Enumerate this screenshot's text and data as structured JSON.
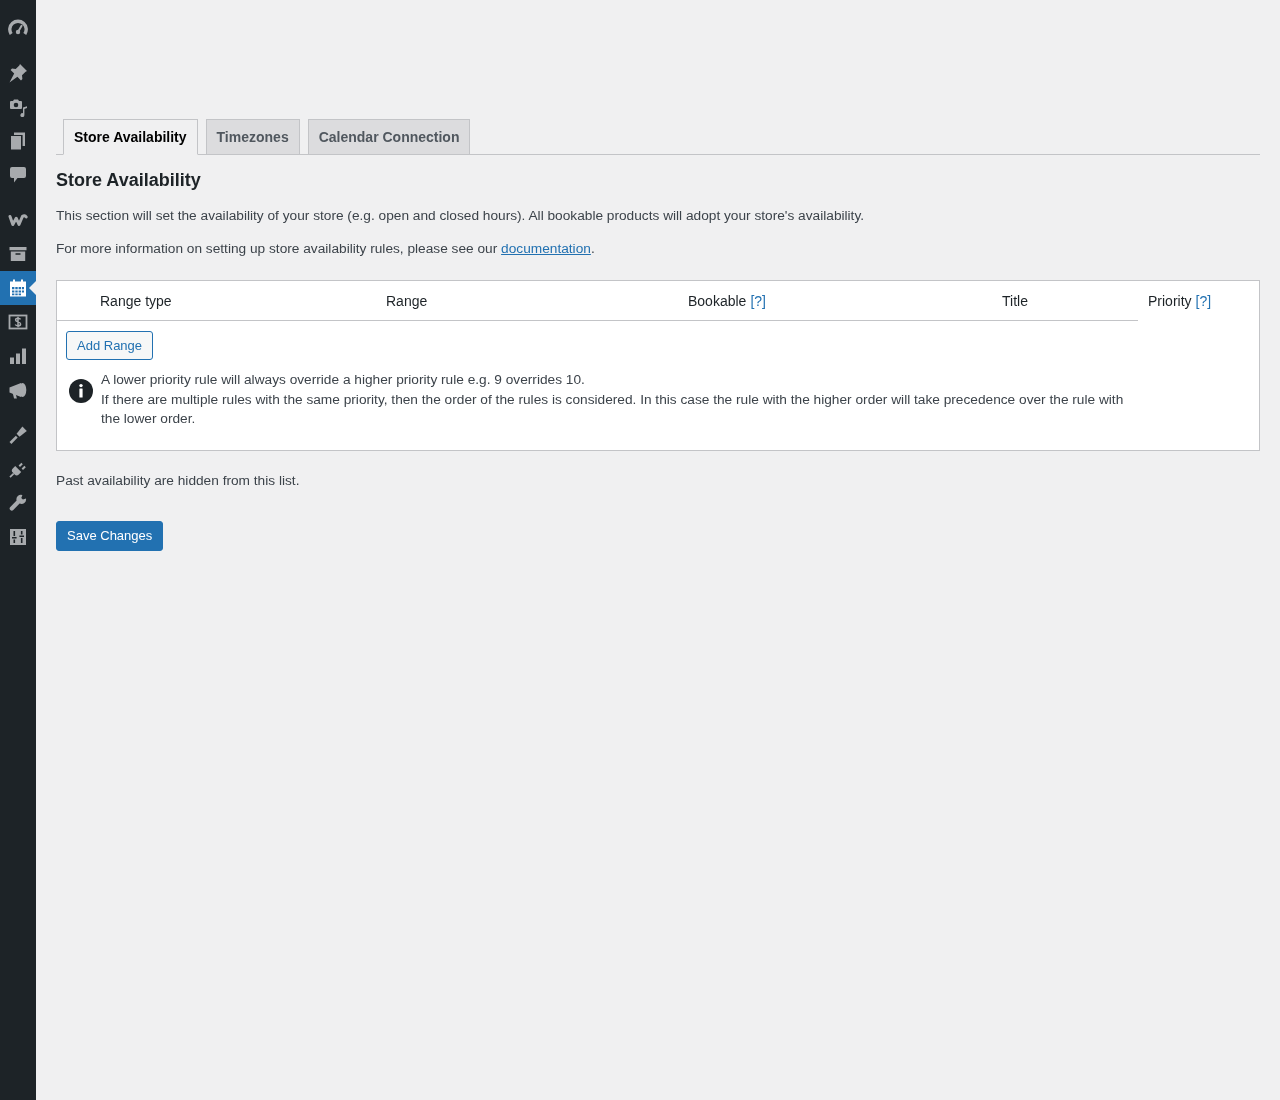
{
  "sidebar": {
    "groups": [
      {
        "items": [
          {
            "selected": false
          }
        ]
      },
      {
        "items": [
          {
            "selected": false
          },
          {
            "selected": false
          },
          {
            "selected": false
          },
          {
            "selected": false
          }
        ]
      },
      {
        "items": [
          {
            "selected": false
          },
          {
            "selected": false
          },
          {
            "selected": true
          },
          {
            "selected": false
          },
          {
            "selected": false
          },
          {
            "selected": false
          }
        ]
      },
      {
        "items": [
          {
            "selected": false
          },
          {
            "selected": false
          },
          {
            "selected": false
          },
          {
            "selected": false
          }
        ]
      }
    ]
  },
  "tabs": [
    {
      "label": "Store Availability",
      "selected": true
    },
    {
      "label": "Timezones",
      "selected": false
    },
    {
      "label": "Calendar Connection",
      "selected": false
    }
  ],
  "section": {
    "title": "Store Availability",
    "description": "This section will set the availability of your store (e.g. open and closed hours). All bookable products will adopt your store's availability.",
    "more_info": {
      "text": "For more information on setting up store availability rules, please see our ",
      "link": "documentation",
      "after": "."
    }
  },
  "rules_table": {
    "columns": [
      {
        "label": "Range type"
      },
      {
        "label": "Range"
      },
      {
        "label": "Bookable",
        "help": "[?]"
      },
      {
        "label": "Title"
      },
      {
        "label": "Priority",
        "help": "[?]"
      }
    ],
    "add_button": "Add Range",
    "notes": [
      "A lower priority rule will always override a higher priority rule e.g. 9 overrides 10.",
      "If there are multiple rules with the same priority, then the order of the rules is considered. In this case the rule with the higher order will take precedence over the rule with the lower order."
    ]
  },
  "footnote": "Past availability are hidden from this list.",
  "save_button": "Save Changes"
}
